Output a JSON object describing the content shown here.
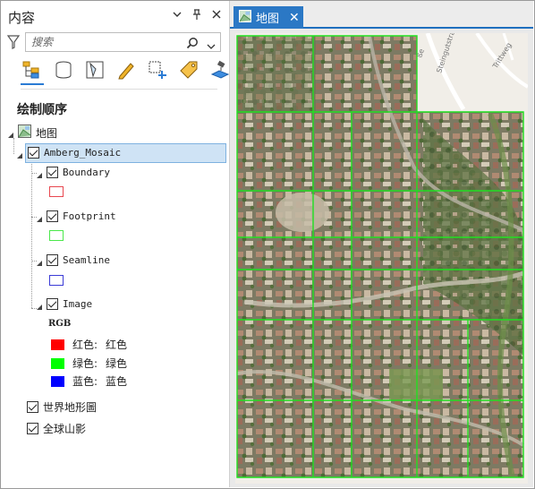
{
  "panel": {
    "title": "内容",
    "search_placeholder": "搜索",
    "toolbar": [
      {
        "name": "draw-order-icon",
        "active": true
      },
      {
        "name": "data-source-icon",
        "active": false
      },
      {
        "name": "selection-icon",
        "active": false
      },
      {
        "name": "editing-icon",
        "active": false
      },
      {
        "name": "snapping-icon",
        "active": false
      },
      {
        "name": "labeling-icon",
        "active": false
      },
      {
        "name": "perspective-imagery-icon",
        "active": false
      }
    ],
    "section_title": "绘制顺序",
    "map_label": "地图",
    "mosaic_label": "Amberg_Mosaic",
    "sublayers": {
      "boundary": {
        "label": "Boundary",
        "color": "#e8474f"
      },
      "footprint": {
        "label": "Footprint",
        "color": "#4be84b"
      },
      "seamline": {
        "label": "Seamline",
        "color": "#3b3bd6"
      },
      "image": {
        "label": "Image"
      }
    },
    "rgb_title": "RGB",
    "rgb": [
      {
        "band": "红色:",
        "value": "红色",
        "color": "#ff0000"
      },
      {
        "band": "绿色:",
        "value": "绿色",
        "color": "#00ff00"
      },
      {
        "band": "蓝色:",
        "value": "蓝色",
        "color": "#0000ff"
      }
    ],
    "basemaps": [
      "世界地形圖",
      "全球山影"
    ]
  },
  "map": {
    "tab_label": "地图",
    "street_labels": [
      "Steingutstraße",
      "Trittweg",
      "ße"
    ]
  }
}
